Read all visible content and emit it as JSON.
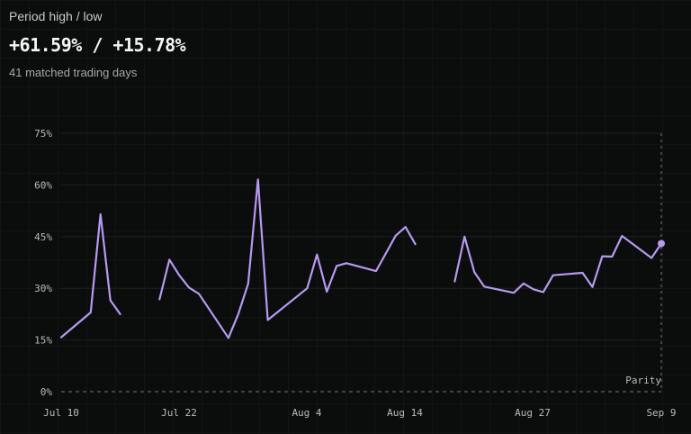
{
  "header": {
    "label": "Period high / low",
    "value": "+61.59% / +15.78%",
    "matched": "41 matched trading days"
  },
  "colors": {
    "line": "#b79af0",
    "grid": "#1f2222",
    "zero_line": "#777b7b",
    "background": "#0b0c0c"
  },
  "chart_data": {
    "type": "line",
    "x_tick_labels": [
      "Jul 10",
      "Jul 22",
      "Aug 4",
      "Aug 14",
      "Aug 27",
      "Sep 9"
    ],
    "y_ticks": [
      0,
      15,
      30,
      45,
      60,
      75
    ],
    "y_tick_labels": [
      "0%",
      "15%",
      "30%",
      "45%",
      "60%",
      "75%"
    ],
    "ylim": [
      0,
      75
    ],
    "grid": true,
    "reference_line": {
      "value": 0,
      "label": "Parity",
      "style": "dashed"
    },
    "series": [
      {
        "segments": [
          [
            {
              "x": "2024-07-10",
              "y": 15.78
            },
            {
              "x": "2024-07-13",
              "y": 23.0
            },
            {
              "x": "2024-07-14",
              "y": 51.5
            },
            {
              "x": "2024-07-15",
              "y": 26.5
            },
            {
              "x": "2024-07-16",
              "y": 22.5
            }
          ],
          [
            {
              "x": "2024-07-20",
              "y": 26.8
            },
            {
              "x": "2024-07-21",
              "y": 38.3
            },
            {
              "x": "2024-07-22",
              "y": 33.8
            },
            {
              "x": "2024-07-23",
              "y": 30.2
            },
            {
              "x": "2024-07-24",
              "y": 28.4
            },
            {
              "x": "2024-07-27",
              "y": 15.6
            },
            {
              "x": "2024-07-28",
              "y": 22.5
            },
            {
              "x": "2024-07-29",
              "y": 31.3
            },
            {
              "x": "2024-07-30",
              "y": 61.59
            },
            {
              "x": "2024-07-31",
              "y": 20.8
            },
            {
              "x": "2024-08-04",
              "y": 30.0
            },
            {
              "x": "2024-08-05",
              "y": 39.8
            },
            {
              "x": "2024-08-06",
              "y": 29.0
            },
            {
              "x": "2024-08-07",
              "y": 36.5
            },
            {
              "x": "2024-08-08",
              "y": 37.3
            },
            {
              "x": "2024-08-11",
              "y": 35.0
            },
            {
              "x": "2024-08-13",
              "y": 45.3
            },
            {
              "x": "2024-08-14",
              "y": 47.8
            },
            {
              "x": "2024-08-15",
              "y": 42.8
            }
          ],
          [
            {
              "x": "2024-08-19",
              "y": 32.0
            },
            {
              "x": "2024-08-20",
              "y": 45.0
            },
            {
              "x": "2024-08-21",
              "y": 34.7
            },
            {
              "x": "2024-08-22",
              "y": 30.5
            },
            {
              "x": "2024-08-25",
              "y": 28.7
            },
            {
              "x": "2024-08-26",
              "y": 31.4
            },
            {
              "x": "2024-08-27",
              "y": 29.7
            },
            {
              "x": "2024-08-28",
              "y": 28.9
            },
            {
              "x": "2024-08-29",
              "y": 33.8
            },
            {
              "x": "2024-09-01",
              "y": 34.5
            },
            {
              "x": "2024-09-02",
              "y": 30.4
            },
            {
              "x": "2024-09-03",
              "y": 39.3
            },
            {
              "x": "2024-09-04",
              "y": 39.2
            },
            {
              "x": "2024-09-05",
              "y": 45.2
            },
            {
              "x": "2024-09-08",
              "y": 38.8
            },
            {
              "x": "2024-09-09",
              "y": 43.0
            }
          ]
        ]
      }
    ],
    "end_marker": {
      "x": "2024-09-09",
      "y": 43.0
    }
  }
}
